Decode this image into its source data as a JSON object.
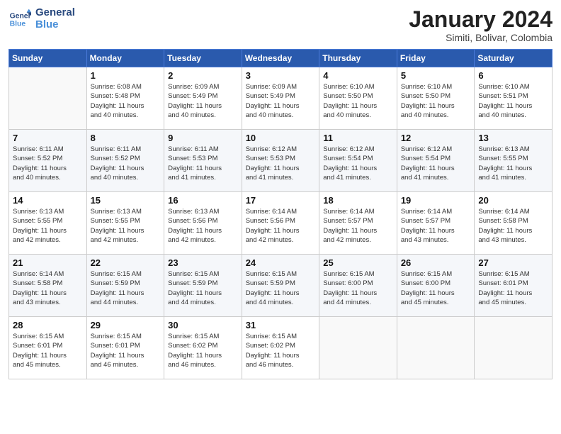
{
  "logo": {
    "line1": "General",
    "line2": "Blue"
  },
  "title": "January 2024",
  "subtitle": "Simiti, Bolivar, Colombia",
  "days_of_week": [
    "Sunday",
    "Monday",
    "Tuesday",
    "Wednesday",
    "Thursday",
    "Friday",
    "Saturday"
  ],
  "weeks": [
    [
      {
        "num": "",
        "info": ""
      },
      {
        "num": "1",
        "info": "Sunrise: 6:08 AM\nSunset: 5:48 PM\nDaylight: 11 hours\nand 40 minutes."
      },
      {
        "num": "2",
        "info": "Sunrise: 6:09 AM\nSunset: 5:49 PM\nDaylight: 11 hours\nand 40 minutes."
      },
      {
        "num": "3",
        "info": "Sunrise: 6:09 AM\nSunset: 5:49 PM\nDaylight: 11 hours\nand 40 minutes."
      },
      {
        "num": "4",
        "info": "Sunrise: 6:10 AM\nSunset: 5:50 PM\nDaylight: 11 hours\nand 40 minutes."
      },
      {
        "num": "5",
        "info": "Sunrise: 6:10 AM\nSunset: 5:50 PM\nDaylight: 11 hours\nand 40 minutes."
      },
      {
        "num": "6",
        "info": "Sunrise: 6:10 AM\nSunset: 5:51 PM\nDaylight: 11 hours\nand 40 minutes."
      }
    ],
    [
      {
        "num": "7",
        "info": "Sunrise: 6:11 AM\nSunset: 5:52 PM\nDaylight: 11 hours\nand 40 minutes."
      },
      {
        "num": "8",
        "info": "Sunrise: 6:11 AM\nSunset: 5:52 PM\nDaylight: 11 hours\nand 40 minutes."
      },
      {
        "num": "9",
        "info": "Sunrise: 6:11 AM\nSunset: 5:53 PM\nDaylight: 11 hours\nand 41 minutes."
      },
      {
        "num": "10",
        "info": "Sunrise: 6:12 AM\nSunset: 5:53 PM\nDaylight: 11 hours\nand 41 minutes."
      },
      {
        "num": "11",
        "info": "Sunrise: 6:12 AM\nSunset: 5:54 PM\nDaylight: 11 hours\nand 41 minutes."
      },
      {
        "num": "12",
        "info": "Sunrise: 6:12 AM\nSunset: 5:54 PM\nDaylight: 11 hours\nand 41 minutes."
      },
      {
        "num": "13",
        "info": "Sunrise: 6:13 AM\nSunset: 5:55 PM\nDaylight: 11 hours\nand 41 minutes."
      }
    ],
    [
      {
        "num": "14",
        "info": "Sunrise: 6:13 AM\nSunset: 5:55 PM\nDaylight: 11 hours\nand 42 minutes."
      },
      {
        "num": "15",
        "info": "Sunrise: 6:13 AM\nSunset: 5:55 PM\nDaylight: 11 hours\nand 42 minutes."
      },
      {
        "num": "16",
        "info": "Sunrise: 6:13 AM\nSunset: 5:56 PM\nDaylight: 11 hours\nand 42 minutes."
      },
      {
        "num": "17",
        "info": "Sunrise: 6:14 AM\nSunset: 5:56 PM\nDaylight: 11 hours\nand 42 minutes."
      },
      {
        "num": "18",
        "info": "Sunrise: 6:14 AM\nSunset: 5:57 PM\nDaylight: 11 hours\nand 42 minutes."
      },
      {
        "num": "19",
        "info": "Sunrise: 6:14 AM\nSunset: 5:57 PM\nDaylight: 11 hours\nand 43 minutes."
      },
      {
        "num": "20",
        "info": "Sunrise: 6:14 AM\nSunset: 5:58 PM\nDaylight: 11 hours\nand 43 minutes."
      }
    ],
    [
      {
        "num": "21",
        "info": "Sunrise: 6:14 AM\nSunset: 5:58 PM\nDaylight: 11 hours\nand 43 minutes."
      },
      {
        "num": "22",
        "info": "Sunrise: 6:15 AM\nSunset: 5:59 PM\nDaylight: 11 hours\nand 44 minutes."
      },
      {
        "num": "23",
        "info": "Sunrise: 6:15 AM\nSunset: 5:59 PM\nDaylight: 11 hours\nand 44 minutes."
      },
      {
        "num": "24",
        "info": "Sunrise: 6:15 AM\nSunset: 5:59 PM\nDaylight: 11 hours\nand 44 minutes."
      },
      {
        "num": "25",
        "info": "Sunrise: 6:15 AM\nSunset: 6:00 PM\nDaylight: 11 hours\nand 44 minutes."
      },
      {
        "num": "26",
        "info": "Sunrise: 6:15 AM\nSunset: 6:00 PM\nDaylight: 11 hours\nand 45 minutes."
      },
      {
        "num": "27",
        "info": "Sunrise: 6:15 AM\nSunset: 6:01 PM\nDaylight: 11 hours\nand 45 minutes."
      }
    ],
    [
      {
        "num": "28",
        "info": "Sunrise: 6:15 AM\nSunset: 6:01 PM\nDaylight: 11 hours\nand 45 minutes."
      },
      {
        "num": "29",
        "info": "Sunrise: 6:15 AM\nSunset: 6:01 PM\nDaylight: 11 hours\nand 46 minutes."
      },
      {
        "num": "30",
        "info": "Sunrise: 6:15 AM\nSunset: 6:02 PM\nDaylight: 11 hours\nand 46 minutes."
      },
      {
        "num": "31",
        "info": "Sunrise: 6:15 AM\nSunset: 6:02 PM\nDaylight: 11 hours\nand 46 minutes."
      },
      {
        "num": "",
        "info": ""
      },
      {
        "num": "",
        "info": ""
      },
      {
        "num": "",
        "info": ""
      }
    ]
  ]
}
